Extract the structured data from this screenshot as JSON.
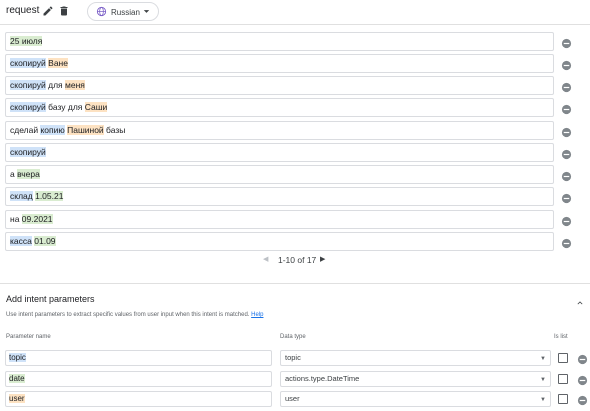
{
  "header": {
    "title": "request",
    "language": "Russian"
  },
  "phrases": [
    {
      "segments": [
        {
          "text": "25 июля",
          "hl": "green"
        }
      ]
    },
    {
      "segments": [
        {
          "text": "скопируй",
          "hl": "blue"
        },
        {
          "text": " ",
          "hl": ""
        },
        {
          "text": "Ване",
          "hl": "orange"
        }
      ]
    },
    {
      "segments": [
        {
          "text": "скопируй",
          "hl": "blue"
        },
        {
          "text": " для ",
          "hl": ""
        },
        {
          "text": "меня",
          "hl": "orange"
        }
      ]
    },
    {
      "segments": [
        {
          "text": "скопируй",
          "hl": "blue"
        },
        {
          "text": " базу для ",
          "hl": ""
        },
        {
          "text": "Саши",
          "hl": "orange"
        }
      ]
    },
    {
      "segments": [
        {
          "text": "сделай ",
          "hl": ""
        },
        {
          "text": "копию",
          "hl": "blue"
        },
        {
          "text": " ",
          "hl": ""
        },
        {
          "text": "Пашиной",
          "hl": "orange"
        },
        {
          "text": " базы",
          "hl": ""
        }
      ]
    },
    {
      "segments": [
        {
          "text": "скопируй",
          "hl": "blue"
        }
      ]
    },
    {
      "segments": [
        {
          "text": "а ",
          "hl": ""
        },
        {
          "text": "вчера",
          "hl": "green"
        }
      ]
    },
    {
      "segments": [
        {
          "text": "склад",
          "hl": "blue"
        },
        {
          "text": " ",
          "hl": ""
        },
        {
          "text": "1.05.21",
          "hl": "green"
        }
      ]
    },
    {
      "segments": [
        {
          "text": "на ",
          "hl": ""
        },
        {
          "text": "09.2021",
          "hl": "green"
        }
      ]
    },
    {
      "segments": [
        {
          "text": "касса",
          "hl": "blue"
        },
        {
          "text": " ",
          "hl": ""
        },
        {
          "text": "01.09",
          "hl": "green"
        }
      ]
    }
  ],
  "pagination": {
    "text": "1-10 of 17"
  },
  "params": {
    "title": "Add intent parameters",
    "description": "Use intent parameters to extract specific values from user input when this intent is matched.",
    "help_label": "Help",
    "col_name": "Parameter name",
    "col_type": "Data type",
    "col_list": "Is list",
    "rows": [
      {
        "name": "topic",
        "hl": "blue",
        "type": "topic"
      },
      {
        "name": "date",
        "hl": "green",
        "type": "actions.type.DateTime"
      },
      {
        "name": "user",
        "hl": "orange",
        "type": "user"
      }
    ]
  },
  "colors": {
    "highlight_blue": "#cfe2f8",
    "highlight_orange": "#fde2c2",
    "highlight_green": "#d9ecd0",
    "link": "#1a73e8"
  }
}
